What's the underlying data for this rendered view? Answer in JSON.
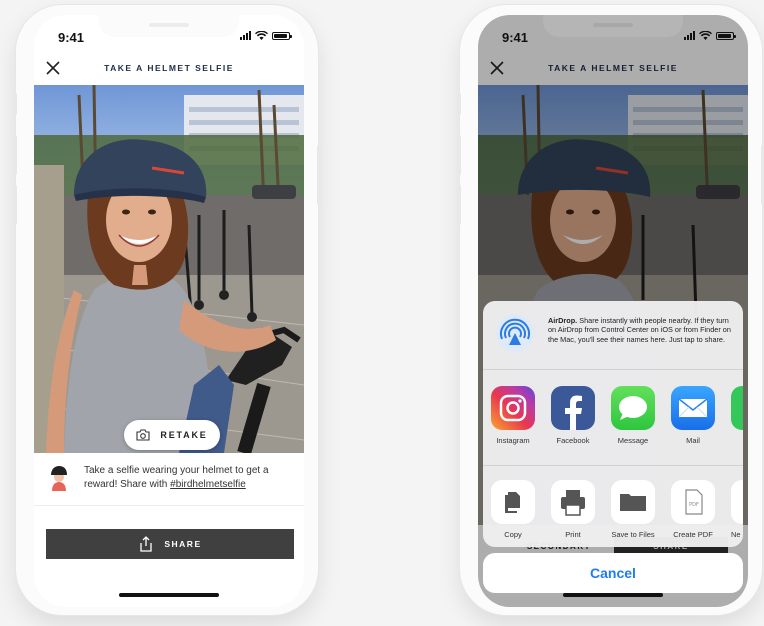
{
  "left_screen": {
    "status": {
      "time": "9:41"
    },
    "nav": {
      "title": "TAKE A HELMET SELFIE"
    },
    "retake": {
      "label": "RETAKE"
    },
    "promo": {
      "text": "Take a selfie wearing your helmet to get a reward! Share with ",
      "hashtag": "#birdhelmetselfie"
    },
    "share": {
      "label": "SHARE"
    }
  },
  "right_screen": {
    "status": {
      "time": "9:41"
    },
    "nav": {
      "title": "TAKE A HELMET SELFIE"
    },
    "background_buttons": {
      "secondary": "SECONDARY",
      "share": "SHARE"
    },
    "share_sheet": {
      "airdrop": {
        "title": "AirDrop.",
        "description": "Share instantly with people nearby. If they turn on AirDrop from Control Center on iOS or from Finder on the Mac, you'll see their names here. Just tap to share."
      },
      "apps": [
        {
          "label": "Instagram",
          "icon": "instagram-icon"
        },
        {
          "label": "Facebook",
          "icon": "facebook-icon"
        },
        {
          "label": "Message",
          "icon": "message-icon"
        },
        {
          "label": "Mail",
          "icon": "mail-icon"
        }
      ],
      "actions": [
        {
          "label": "Copy",
          "icon": "copy-icon"
        },
        {
          "label": "Print",
          "icon": "print-icon"
        },
        {
          "label": "Save to Files",
          "icon": "folder-icon"
        },
        {
          "label": "Create PDF",
          "icon": "pdf-icon"
        },
        {
          "label": "Ne",
          "icon": "partial-icon"
        }
      ],
      "cancel": "Cancel"
    }
  },
  "colors": {
    "nav_title": "#1e2d4b",
    "share_button": "#404040",
    "cancel_text": "#1f7cf1",
    "helmet": "#33435b"
  }
}
